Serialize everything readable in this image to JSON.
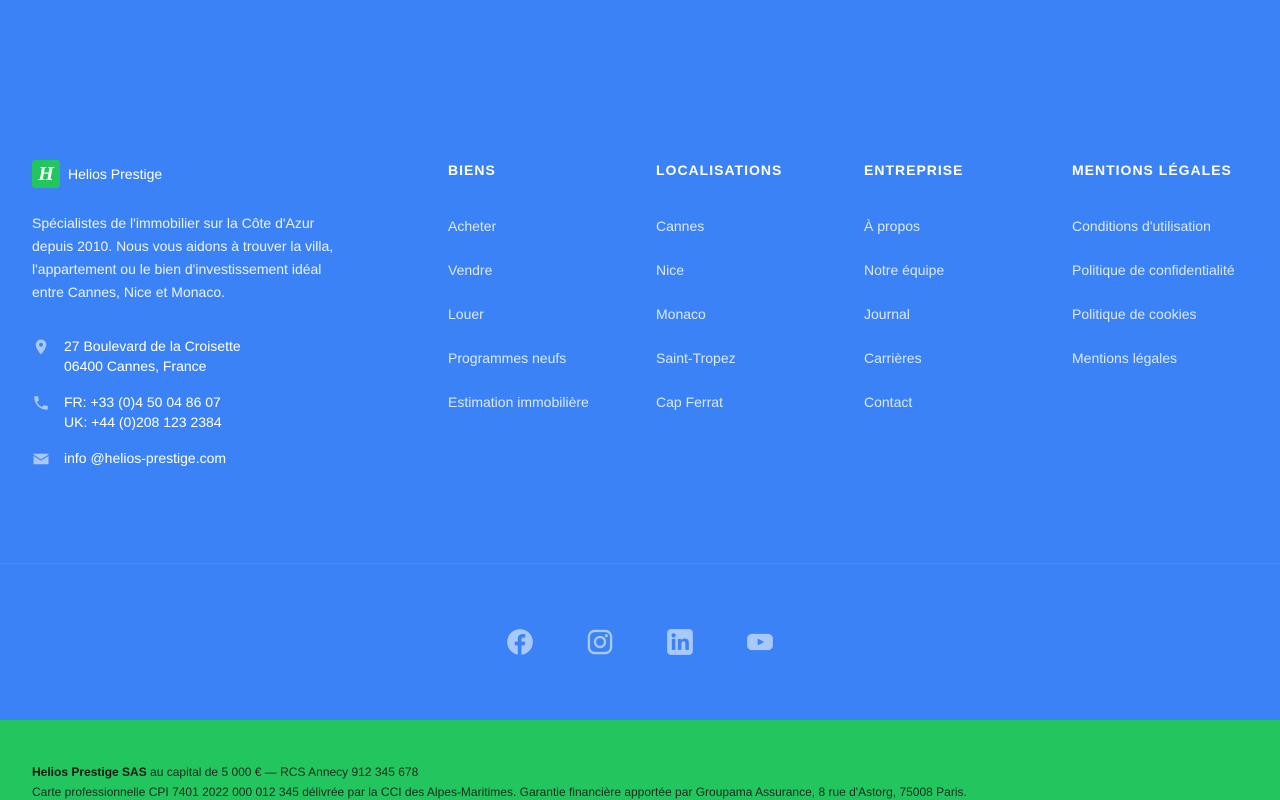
{
  "brand": {
    "logo_letter": "H",
    "name": "Helios Prestige",
    "description": "Spécialistes de l'immobilier sur la Côte d'Azur depuis 2010. Nous vous aidons à trouver la villa, l'appartement ou le bien d'investissement idéal entre Cannes, Nice et Monaco."
  },
  "contact": {
    "address_line1": "27 Boulevard de la Croisette",
    "address_line2": "06400 Cannes, France",
    "phone_fr": "FR: +33 (0)4 50 04 86 07",
    "phone_uk": "UK: +44 (0)208 123 2384",
    "email": "info @helios-prestige.com"
  },
  "columns": [
    {
      "heading": "BIENS",
      "links": [
        "Acheter",
        "Vendre",
        "Louer",
        "Programmes neufs",
        "Estimation immobilière"
      ]
    },
    {
      "heading": "LOCALISATIONS",
      "links": [
        "Cannes",
        "Nice",
        "Monaco",
        "Saint-Tropez",
        "Cap Ferrat"
      ]
    },
    {
      "heading": "ENTREPRISE",
      "links": [
        "À propos",
        "Notre équipe",
        "Journal",
        "Carrières",
        "Contact"
      ]
    },
    {
      "heading": "MENTIONS LÉGALES",
      "links": [
        "Conditions d'utilisation",
        "Politique de confidentialité",
        "Politique de cookies",
        "Mentions légales"
      ]
    }
  ],
  "social": [
    "facebook-icon",
    "instagram-icon",
    "linkedin-icon",
    "youtube-icon"
  ],
  "legal": {
    "company_bold": "Helios Prestige SAS",
    "line1_rest": " au capital de 5 000 € — RCS Annecy 912 345 678",
    "line2": "Carte professionnelle CPI 7401 2022 000 012 345 délivrée par la CCI des Alpes-Maritimes. Garantie financière apportée par Groupama Assurance, 8 rue d'Astorg, 75008 Paris."
  },
  "colors": {
    "background": "#3b82f6",
    "accent_green": "#22c55e",
    "icon_tint": "#a9c8fb"
  }
}
